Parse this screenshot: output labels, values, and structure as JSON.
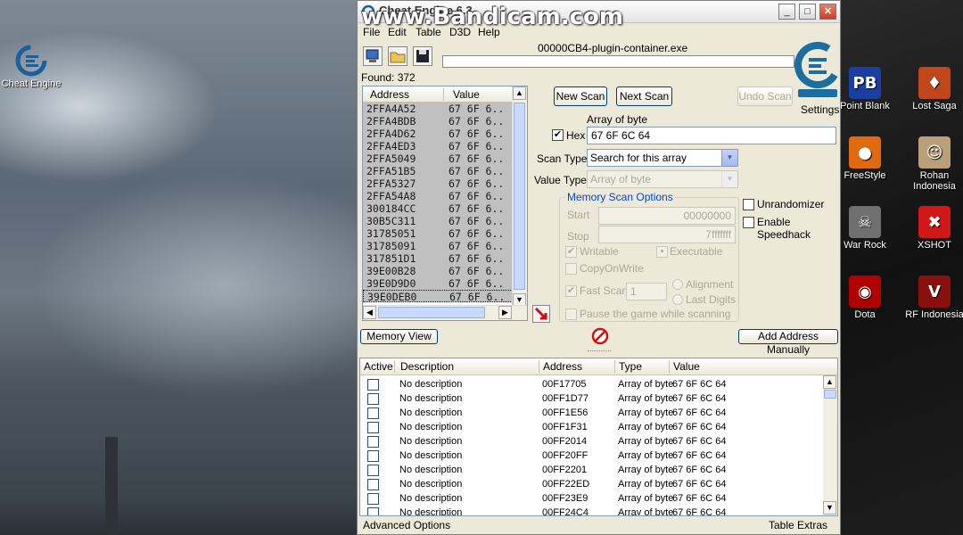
{
  "watermark": "www.Bandicam.com",
  "desktop": {
    "left_icon": {
      "label": "Cheat Engine"
    },
    "right_icons": [
      {
        "label": "Point Blank",
        "color": "#1a3fa0",
        "glyph": "PB"
      },
      {
        "label": "Lost Saga",
        "color": "#c0471c",
        "glyph": "♦"
      },
      {
        "label": "FreeStyle",
        "color": "#e06a10",
        "glyph": "●"
      },
      {
        "label": "Rohan Indonesia",
        "color": "#b9a07a",
        "glyph": "☺"
      },
      {
        "label": "War Rock",
        "color": "#6f6f6f",
        "glyph": "☠"
      },
      {
        "label": "XSHOT",
        "color": "#d01818",
        "glyph": "✖"
      },
      {
        "label": "Dota",
        "color": "#b00000",
        "glyph": "◉"
      },
      {
        "label": "RF Indonesia",
        "color": "#8a1010",
        "glyph": "V"
      }
    ]
  },
  "window": {
    "title": "Cheat Engine 6.3"
  },
  "menu": [
    "File",
    "Edit",
    "Table",
    "D3D",
    "Help"
  ],
  "process": "00000CB4-plugin-container.exe",
  "found": "Found: 372",
  "settings_label": "Settings",
  "results": {
    "headers": {
      "address": "Address",
      "value": "Value"
    },
    "rows": [
      {
        "address": "2FFA4A52",
        "value": "67 6F 6.."
      },
      {
        "address": "2FFA4BDB",
        "value": "67 6F 6.."
      },
      {
        "address": "2FFA4D62",
        "value": "67 6F 6.."
      },
      {
        "address": "2FFA4ED3",
        "value": "67 6F 6.."
      },
      {
        "address": "2FFA5049",
        "value": "67 6F 6.."
      },
      {
        "address": "2FFA51B5",
        "value": "67 6F 6.."
      },
      {
        "address": "2FFA5327",
        "value": "67 6F 6.."
      },
      {
        "address": "2FFA54A8",
        "value": "67 6F 6.."
      },
      {
        "address": "300184CC",
        "value": "67 6F 6.."
      },
      {
        "address": "30B5C311",
        "value": "67 6F 6.."
      },
      {
        "address": "31785051",
        "value": "67 6F 6.."
      },
      {
        "address": "31785091",
        "value": "67 6F 6.."
      },
      {
        "address": "317851D1",
        "value": "67 6F 6.."
      },
      {
        "address": "39E00B28",
        "value": "67 6F 6.."
      },
      {
        "address": "39E0D9D0",
        "value": "67 6F 6.."
      },
      {
        "address": "39E0DEB0",
        "value": "67 6F 6.."
      }
    ]
  },
  "scan": {
    "new_scan": "New Scan",
    "next_scan": "Next Scan",
    "undo_scan": "Undo Scan",
    "value_type_caption": "Array of byte",
    "hex_label": "Hex",
    "hex_value": "67 6F 6C 64",
    "scan_type_label": "Scan Type",
    "scan_type_value": "Search for this array",
    "value_type_label": "Value Type",
    "value_type_value": "Array of byte",
    "memory_options_title": "Memory Scan Options",
    "start_label": "Start",
    "start_value": "00000000",
    "stop_label": "Stop",
    "stop_value": "7fffffff",
    "writable": "Writable",
    "executable": "Executable",
    "copy_on_write": "CopyOnWrite",
    "fast_scan": "Fast Scan",
    "fast_scan_value": "1",
    "alignment": "Alignment",
    "last_digits": "Last Digits",
    "pause_game": "Pause the game while scanning",
    "unrandomizer": "Unrandomizer",
    "enable_speedhack": "Enable Speedhack"
  },
  "memory_view": "Memory View",
  "add_address_manually": "Add Address Manually",
  "table": {
    "headers": {
      "active": "Active",
      "description": "Description",
      "address": "Address",
      "type": "Type",
      "value": "Value"
    },
    "rows": [
      {
        "description": "No description",
        "address": "00F17705",
        "type": "Array of byte",
        "value": "67 6F 6C 64"
      },
      {
        "description": "No description",
        "address": "00FF1D77",
        "type": "Array of byte",
        "value": "67 6F 6C 64"
      },
      {
        "description": "No description",
        "address": "00FF1E56",
        "type": "Array of byte",
        "value": "67 6F 6C 64"
      },
      {
        "description": "No description",
        "address": "00FF1F31",
        "type": "Array of byte",
        "value": "67 6F 6C 64"
      },
      {
        "description": "No description",
        "address": "00FF2014",
        "type": "Array of byte",
        "value": "67 6F 6C 64"
      },
      {
        "description": "No description",
        "address": "00FF20FF",
        "type": "Array of byte",
        "value": "67 6F 6C 64"
      },
      {
        "description": "No description",
        "address": "00FF2201",
        "type": "Array of byte",
        "value": "67 6F 6C 64"
      },
      {
        "description": "No description",
        "address": "00FF22ED",
        "type": "Array of byte",
        "value": "67 6F 6C 64"
      },
      {
        "description": "No description",
        "address": "00FF23E9",
        "type": "Array of byte",
        "value": "67 6F 6C 64"
      },
      {
        "description": "No description",
        "address": "00FF24C4",
        "type": "Array of byte",
        "value": "67 6F 6C 64"
      }
    ]
  },
  "advanced_options": "Advanced Options",
  "table_extras": "Table Extras"
}
